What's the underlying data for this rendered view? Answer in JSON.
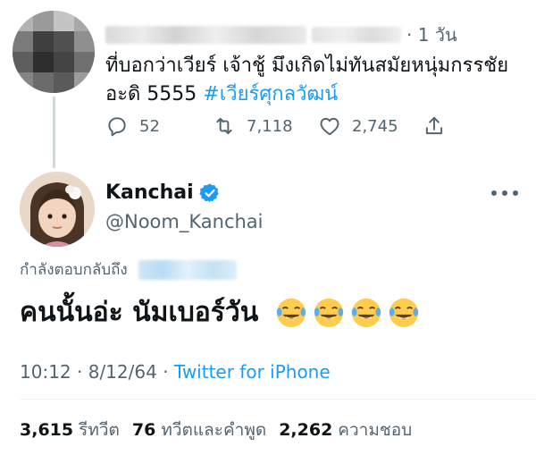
{
  "parent_tweet": {
    "time": "· 1 วัน",
    "text": "ที่บอกว่าเวียร์ เจ้าชู้ มึงเกิดไม่ทันสมัยหนุ่มกรรชัย อะดิ  5555 ",
    "hashtag": "#เวียร์ศุกลวัฒน์",
    "reply_count": "52",
    "retweet_count": "7,118",
    "like_count": "2,745",
    "icons": [
      "reply-icon",
      "retweet-icon",
      "like-icon",
      "share-icon"
    ]
  },
  "reply_tweet": {
    "display_name": "Kanchai",
    "handle": "@Noom_Kanchai",
    "replying_to_label": "กำลังตอบกลับถึง",
    "text": "คนนั้นอ่ะ นัมเบอร์วัน",
    "emoji_count": 4,
    "time": "10:12",
    "date": "8/12/64",
    "source": "Twitter for iPhone"
  },
  "stats": {
    "retweets": "3,615",
    "retweets_label": "รีทวีต",
    "quotes": "76",
    "quotes_label": "ทวีตและคำพูด",
    "likes": "2,262",
    "likes_label": "ความชอบ"
  },
  "colors": {
    "accent": "#1d9bf0",
    "secondary_text": "#536471",
    "primary_text": "#0f1419",
    "thread_line": "#cfd9de"
  }
}
